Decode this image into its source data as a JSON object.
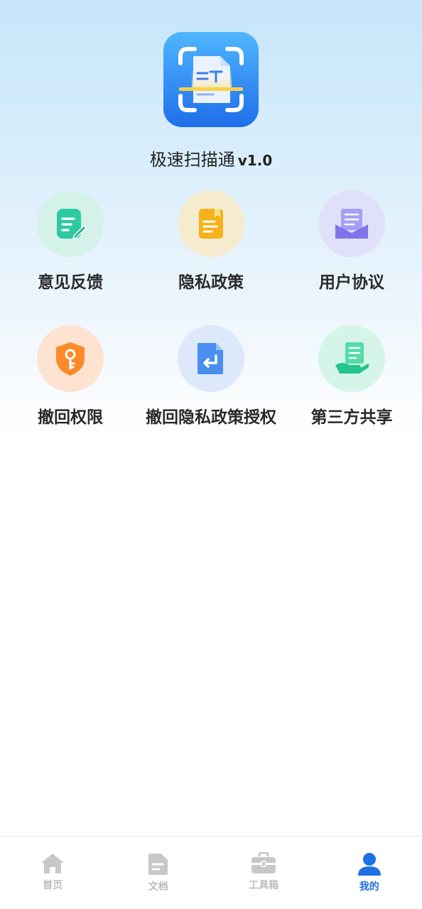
{
  "app": {
    "name": "极速扫描通",
    "version": "v1.0"
  },
  "menu": [
    {
      "label": "意见反馈",
      "icon": "feedback-icon",
      "color": "#2ec9a0"
    },
    {
      "label": "隐私政策",
      "icon": "privacy-policy-icon",
      "color": "#f6b21b"
    },
    {
      "label": "用户协议",
      "icon": "user-agreement-icon",
      "color": "#8f86ee"
    },
    {
      "label": "撤回权限",
      "icon": "revoke-permission-icon",
      "color": "#fb8a2a"
    },
    {
      "label": "撤回隐私政策授权",
      "icon": "revoke-privacy-icon",
      "color": "#4a8ff0"
    },
    {
      "label": "第三方共享",
      "icon": "third-party-share-icon",
      "color": "#2fd29a"
    }
  ],
  "tabs": [
    {
      "label": "首页",
      "icon": "home-icon"
    },
    {
      "label": "文档",
      "icon": "document-icon"
    },
    {
      "label": "工具箱",
      "icon": "toolbox-icon"
    },
    {
      "label": "我的",
      "icon": "user-icon",
      "active": true
    }
  ]
}
